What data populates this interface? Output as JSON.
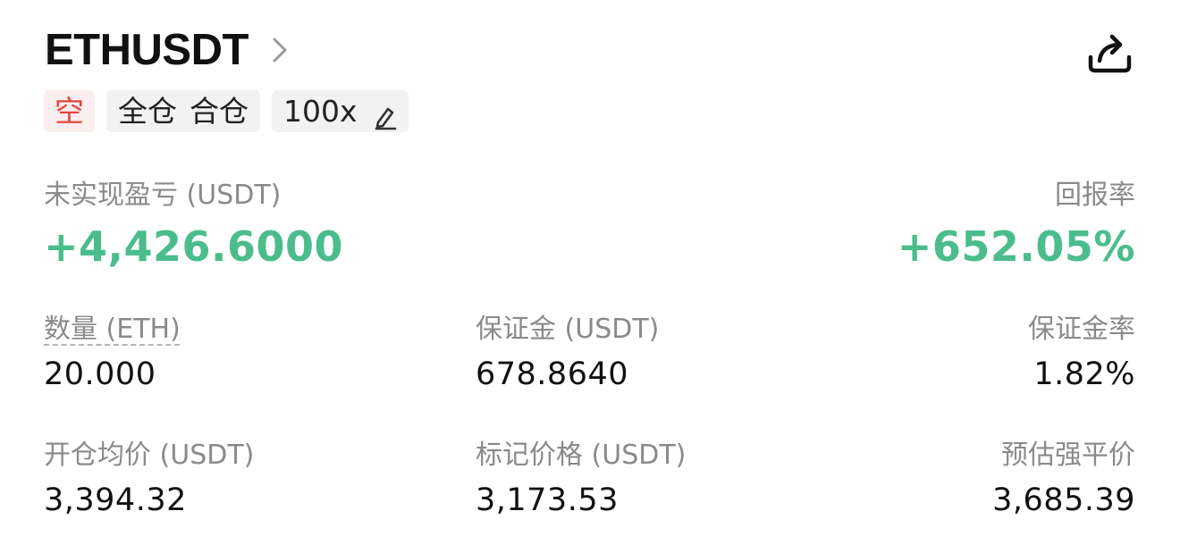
{
  "header": {
    "symbol": "ETHUSDT",
    "icons": {
      "chevron": "chevron-right-icon",
      "share": "share-icon"
    }
  },
  "tags": {
    "side": "空",
    "margin_mode_1": "全仓",
    "margin_mode_2": "合仓",
    "leverage": "100x",
    "edit_icon": "edit-icon"
  },
  "pnl": {
    "label": "未实现盈亏 (USDT)",
    "value": "+4,426.6000",
    "roi_label": "回报率",
    "roi_value": "+652.05%"
  },
  "stats": {
    "quantity_label": "数量 (ETH)",
    "quantity_value": "20.000",
    "margin_label": "保证金 (USDT)",
    "margin_value": "678.8640",
    "margin_ratio_label": "保证金率",
    "margin_ratio_value": "1.82%",
    "entry_price_label": "开仓均价 (USDT)",
    "entry_price_value": "3,394.32",
    "mark_price_label": "标记价格 (USDT)",
    "mark_price_value": "3,173.53",
    "liq_price_label": "预估强平价",
    "liq_price_value": "3,685.39"
  },
  "colors": {
    "profit_green": "#4bbd8c",
    "short_red": "#e0483f",
    "label_gray": "#8a8a8a",
    "tag_bg": "#f2f2f2"
  }
}
